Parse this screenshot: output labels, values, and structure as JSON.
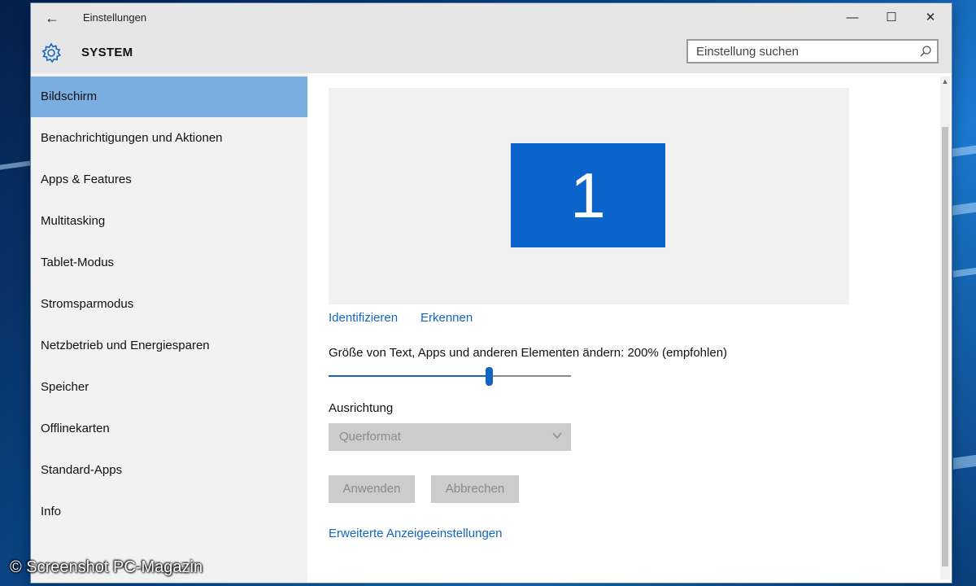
{
  "window": {
    "title": "Einstellungen",
    "minimize": "—",
    "maximize": "☐",
    "close": "✕"
  },
  "header": {
    "title": "SYSTEM",
    "search_placeholder": "Einstellung suchen"
  },
  "sidebar": {
    "items": [
      {
        "label": "Bildschirm",
        "active": true
      },
      {
        "label": "Benachrichtigungen und Aktionen"
      },
      {
        "label": "Apps & Features"
      },
      {
        "label": "Multitasking"
      },
      {
        "label": "Tablet-Modus"
      },
      {
        "label": "Stromsparmodus"
      },
      {
        "label": "Netzbetrieb und Energiesparen"
      },
      {
        "label": "Speicher"
      },
      {
        "label": "Offlinekarten"
      },
      {
        "label": "Standard-Apps"
      },
      {
        "label": "Info"
      }
    ]
  },
  "content": {
    "monitor_number": "1",
    "identify_link": "Identifizieren",
    "detect_link": "Erkennen",
    "scale_label": "Größe von Text, Apps und anderen Elementen ändern: 200% (empfohlen)",
    "scale_value": 0.66,
    "orientation_label": "Ausrichtung",
    "orientation_value": "Querformat",
    "apply_button": "Anwenden",
    "cancel_button": "Abbrechen",
    "advanced_link": "Erweiterte Anzeigeeinstellungen"
  },
  "watermark": "© Screenshot PC-Magazin",
  "colors": {
    "accent": "#1565c0",
    "active_nav": "#7aaee0",
    "monitor": "#0b63cc"
  }
}
